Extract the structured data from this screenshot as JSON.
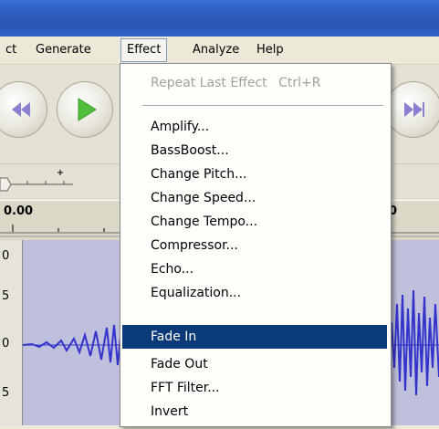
{
  "menubar": {
    "items": [
      "ct",
      "Generate",
      "Effect",
      "Analyze",
      "Help"
    ]
  },
  "ruler": {
    "left_value": "0.00",
    "right_value": "0"
  },
  "track_scale": [
    "0",
    "5",
    "0",
    "5"
  ],
  "effect_menu": {
    "repeat_label": "Repeat Last Effect",
    "repeat_shortcut": "Ctrl+R",
    "items": [
      "Amplify...",
      "BassBoost...",
      "Change Pitch...",
      "Change Speed...",
      "Change Tempo...",
      "Compressor...",
      "Echo...",
      "Equalization...",
      "Fade In",
      "Fade Out",
      "FFT Filter...",
      "Invert"
    ],
    "selected_item": "Fade In"
  },
  "colors": {
    "title_bar": "#2f5fc0",
    "menu_highlight": "#0b3a78",
    "waveform": "#3333cc",
    "play_green": "#4fbf3a"
  },
  "icons": {
    "rewind": "skip-to-start-icon",
    "play": "play-icon",
    "end": "skip-to-end-icon"
  }
}
